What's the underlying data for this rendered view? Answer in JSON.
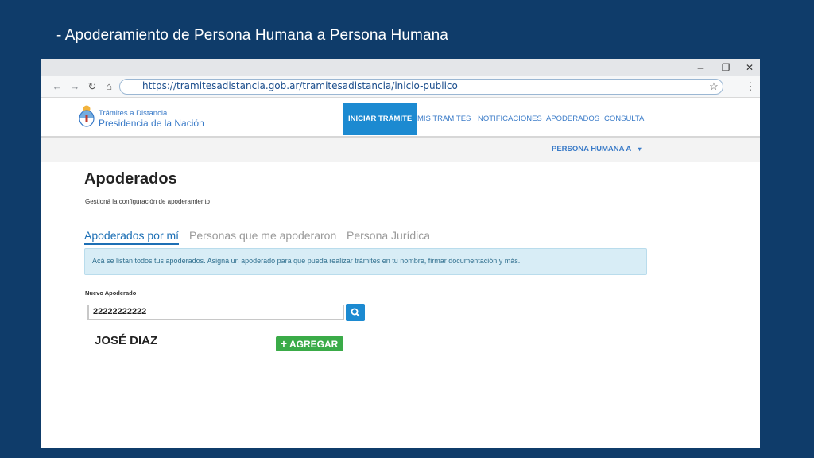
{
  "slide": {
    "title": "- Apoderamiento de Persona Humana a Persona Humana"
  },
  "browser": {
    "url": "https://tramitesadistancia.gob.ar/tramitesadistancia/inicio-publico",
    "controls": {
      "minimize": "‒",
      "restore": "❐",
      "close": "✕"
    },
    "nav": {
      "back": "←",
      "forward": "→",
      "reload": "↻",
      "home": "⌂",
      "star": "☆",
      "menu": "⋮"
    }
  },
  "site": {
    "brand_small": "Trámites a Distancia",
    "brand_big": "Presidencia de la Nación",
    "nav": [
      "INICIAR TRÁMITE",
      "MIS TRÁMITES",
      "NOTIFICACIONES",
      "APODERADOS",
      "CONSULTA"
    ],
    "user": "PERSONA HUMANA A",
    "user_caret": "▾"
  },
  "page": {
    "title": "Apoderados",
    "subtitle": "Gestioná la configuración de apoderamiento",
    "tabs": [
      "Apoderados por mí",
      "Personas que me apoderaron",
      "Persona Jurídica"
    ],
    "info": "Acá se listan todos tus apoderados. Asigná un apoderado para que pueda realizar trámites en tu nombre, firmar documentación y más.",
    "field_label": "Nuevo Apoderado",
    "field_value": "22222222222",
    "result_name": "JOSÉ DIAZ",
    "add_label": "AGREGAR",
    "add_plus": "+"
  },
  "colors": {
    "slide_bg": "#0f3c6a",
    "accent": "#1c8ad1",
    "link": "#3a7bc8",
    "add_button": "#3aab48",
    "info_bg": "#d8edf6"
  },
  "icons": [
    "back-icon",
    "forward-icon",
    "reload-icon",
    "home-icon",
    "star-icon",
    "menu-icon",
    "search-icon",
    "plus-icon",
    "caret-down-icon",
    "coat-of-arms-logo"
  ]
}
